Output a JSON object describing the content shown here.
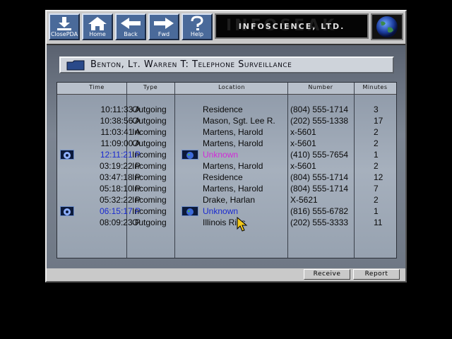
{
  "toolbar": {
    "buttons": [
      {
        "label": "ClosePDA",
        "icon": "close-pda-icon"
      },
      {
        "label": "Home",
        "icon": "home-icon"
      },
      {
        "label": "Back",
        "icon": "back-arrow-icon"
      },
      {
        "label": "Fwd",
        "icon": "forward-arrow-icon"
      },
      {
        "label": "Help",
        "icon": "help-icon"
      }
    ],
    "brand": "InfoScience, Ltd.",
    "brand_watermark": "INFOSEAK"
  },
  "panel": {
    "title": "Benton, Lt. Warren T: Telephone Surveillance"
  },
  "table": {
    "columns": [
      "Time",
      "Type",
      "Location",
      "Number",
      "Minutes"
    ],
    "rows": [
      {
        "time": "10:11:33 A",
        "type": "Outgoing",
        "location": "Residence",
        "number": "(804) 555-1714",
        "minutes": "3",
        "highlight": ""
      },
      {
        "time": "10:38:56 A",
        "type": "Outgoing",
        "location": "Mason, Sgt. Lee R.",
        "number": "(202) 555-1338",
        "minutes": "17",
        "highlight": ""
      },
      {
        "time": "11:03:41 A",
        "type": "Incoming",
        "location": "Martens, Harold",
        "number": "x-5601",
        "minutes": "2",
        "highlight": ""
      },
      {
        "time": "11:09:00 A",
        "type": "Outgoing",
        "location": "Martens, Harold",
        "number": "x-5601",
        "minutes": "2",
        "highlight": ""
      },
      {
        "time": "12:11:21 P",
        "type": "Incoming",
        "location": "Unknown",
        "number": "(410) 555-7654",
        "minutes": "1",
        "highlight": "pink"
      },
      {
        "time": "03:19:22 P",
        "type": "Incoming",
        "location": "Martens, Harold",
        "number": "x-5601",
        "minutes": "2",
        "highlight": ""
      },
      {
        "time": "03:47:18 P",
        "type": "Incoming",
        "location": "Residence",
        "number": "(804) 555-1714",
        "minutes": "12",
        "highlight": ""
      },
      {
        "time": "05:18:10 P",
        "type": "Incoming",
        "location": "Martens, Harold",
        "number": "(804) 555-1714",
        "minutes": "7",
        "highlight": ""
      },
      {
        "time": "05:32:22 P",
        "type": "Incoming",
        "location": "Drake, Harlan",
        "number": "X-5621",
        "minutes": "2",
        "highlight": ""
      },
      {
        "time": "06:15:17 P",
        "type": "Incoming",
        "location": "Unknown",
        "number": "(816) 555-6782",
        "minutes": "1",
        "highlight": "blue"
      },
      {
        "time": "08:09:23 P",
        "type": "Outgoing",
        "location": "Illinois Ribs",
        "number": "(202) 555-3333",
        "minutes": "11",
        "highlight": ""
      }
    ]
  },
  "bottom": {
    "receive_label": "Receive",
    "report_label": "Report"
  },
  "colors": {
    "toolbar_button": "#4a6a9a",
    "highlight_time": "#1a2ad0",
    "unknown_pink": "#d22ad8",
    "unknown_blue": "#1a2ad0"
  }
}
